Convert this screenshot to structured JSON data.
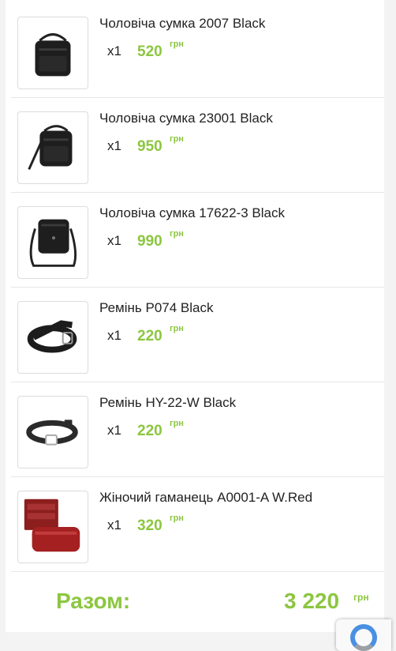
{
  "cart": {
    "items": [
      {
        "name": "Чоловіча сумка 2007 Black",
        "qty": "x1",
        "price": "520",
        "currency": "грн",
        "image_icon": "messenger-bag-icon"
      },
      {
        "name": "Чоловіча сумка 23001 Black",
        "qty": "x1",
        "price": "950",
        "currency": "грн",
        "image_icon": "crossbody-bag-icon"
      },
      {
        "name": "Чоловіча сумка 17622-3 Black",
        "qty": "x1",
        "price": "990",
        "currency": "грн",
        "image_icon": "shoulder-bag-icon"
      },
      {
        "name": "Ремінь P074 Black",
        "qty": "x1",
        "price": "220",
        "currency": "грн",
        "image_icon": "belt-icon"
      },
      {
        "name": "Ремінь HY-22-W Black",
        "qty": "x1",
        "price": "220",
        "currency": "грн",
        "image_icon": "belt-icon"
      },
      {
        "name": "Жіночий гаманець A0001-A W.Red",
        "qty": "x1",
        "price": "320",
        "currency": "грн",
        "image_icon": "wallet-icon"
      }
    ],
    "total": {
      "label": "Разом:",
      "value": "3 220",
      "currency": "грн"
    }
  },
  "colors": {
    "accent": "#8cc640",
    "text": "#222222",
    "divider": "#e6e6e6"
  }
}
